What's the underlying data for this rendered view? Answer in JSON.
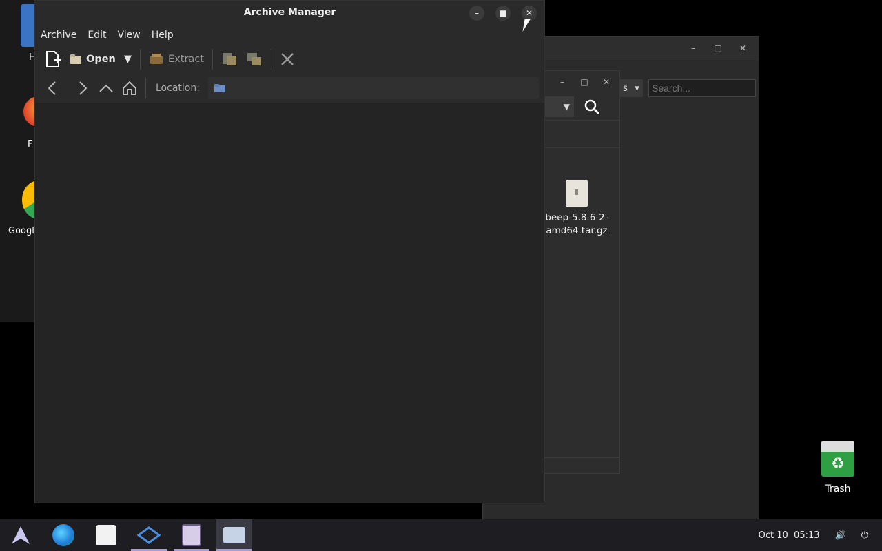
{
  "desktop": {
    "icons": [
      {
        "label": "H"
      },
      {
        "label": "F"
      },
      {
        "label": "Googl"
      }
    ],
    "trash_label": "Trash"
  },
  "archive_manager": {
    "title": "Archive Manager",
    "menus": [
      "Archive",
      "Edit",
      "View",
      "Help"
    ],
    "toolbar": {
      "open_label": "Open",
      "extract_label": "Extract"
    },
    "location_label": "Location:"
  },
  "background_window": {
    "search_placeholder": "Search...",
    "dropdown_text": "s",
    "file_name": "beep-5.8.6-2-amd64.tar.gz"
  },
  "taskbar": {
    "date": "Oct 10",
    "time": "05:13"
  }
}
